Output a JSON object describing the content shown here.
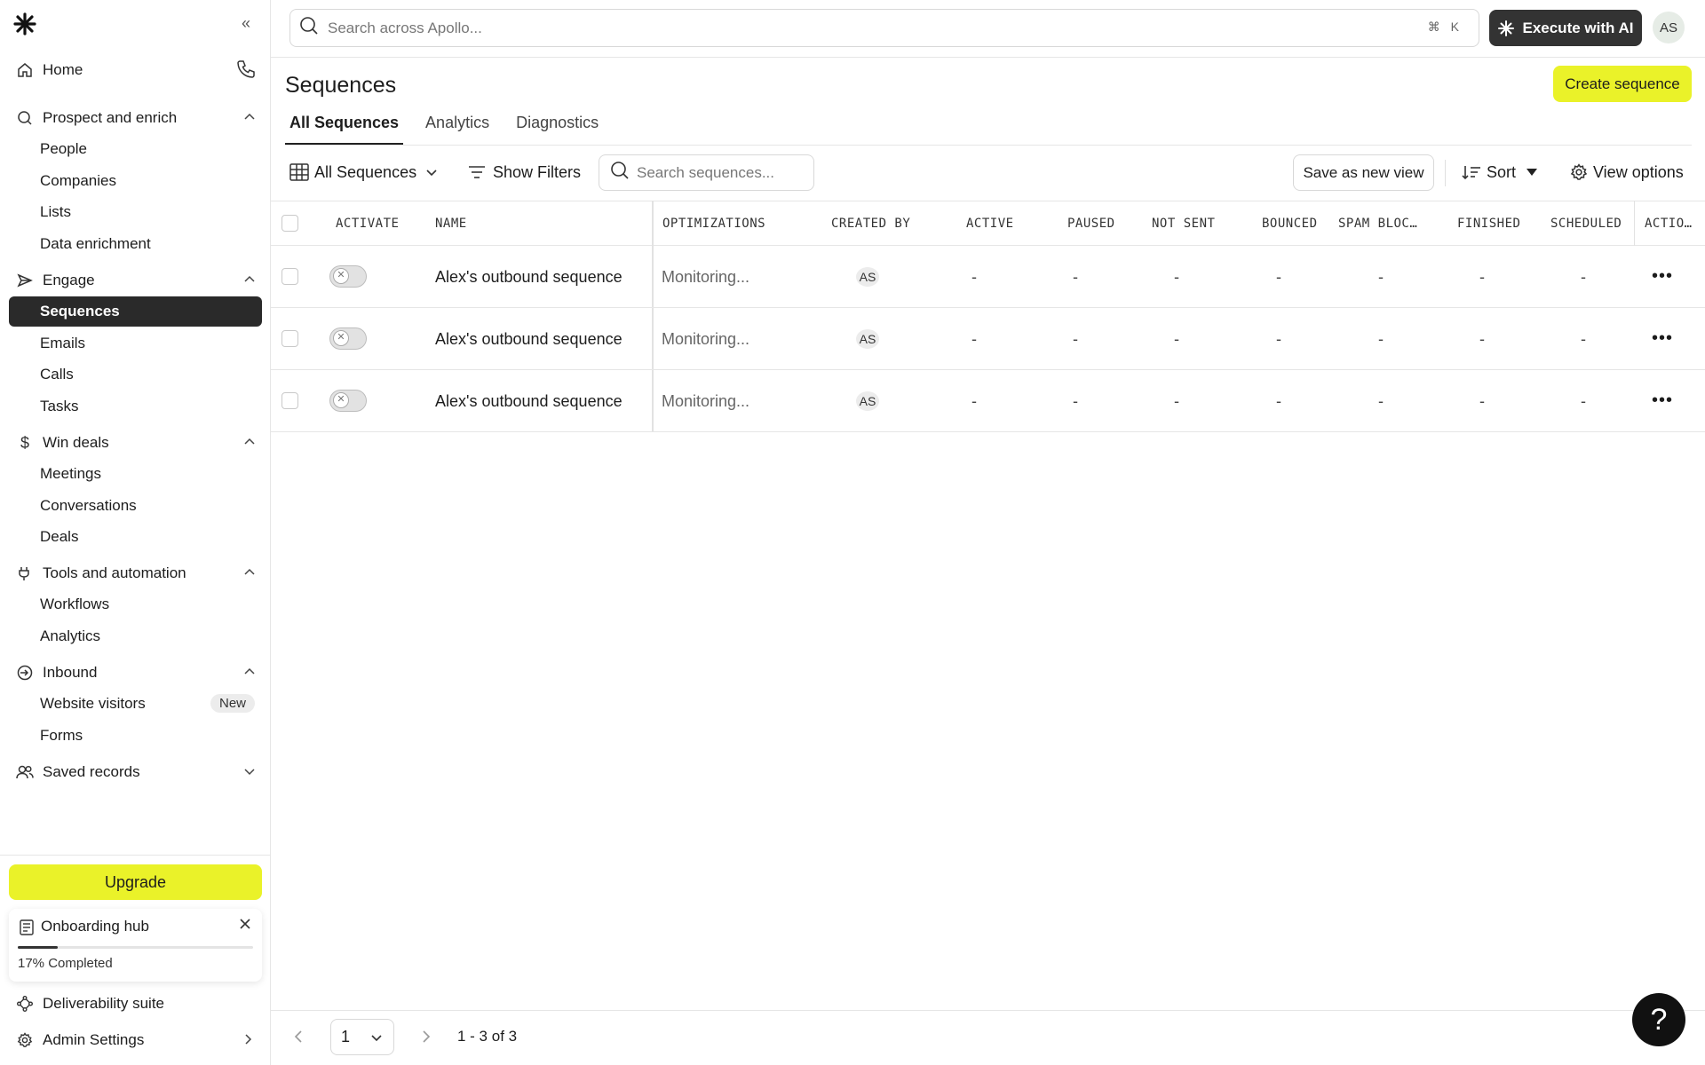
{
  "sidebar": {
    "home": "Home",
    "groups": {
      "prospect": {
        "label": "Prospect and enrich",
        "items": [
          "People",
          "Companies",
          "Lists",
          "Data enrichment"
        ]
      },
      "engage": {
        "label": "Engage",
        "items": [
          "Sequences",
          "Emails",
          "Calls",
          "Tasks"
        ]
      },
      "win": {
        "label": "Win deals",
        "items": [
          "Meetings",
          "Conversations",
          "Deals"
        ]
      },
      "tools": {
        "label": "Tools and automation",
        "items": [
          "Workflows",
          "Analytics"
        ]
      },
      "inbound": {
        "label": "Inbound",
        "items": [
          "Website visitors",
          "Forms"
        ]
      },
      "saved": {
        "label": "Saved records"
      }
    },
    "new_badge": "New",
    "upgrade": "Upgrade",
    "onboarding": {
      "title": "Onboarding hub",
      "progress_text": "17% Completed",
      "progress": 0.17
    },
    "deliverability": "Deliverability suite",
    "admin": "Admin Settings"
  },
  "topbar": {
    "search_placeholder": "Search across Apollo...",
    "shortcut": "⌘ K",
    "execute_ai": "Execute with AI",
    "avatar": "AS"
  },
  "header": {
    "title": "Sequences",
    "create": "Create sequence",
    "tabs": [
      "All Sequences",
      "Analytics",
      "Diagnostics"
    ]
  },
  "toolbar": {
    "view": "All Sequences",
    "filters": "Show Filters",
    "search_placeholder": "Search sequences...",
    "save_view": "Save as new view",
    "sort": "Sort",
    "view_options": "View options"
  },
  "table": {
    "columns": [
      "ACTIVATE",
      "NAME",
      "OPTIMIZATIONS",
      "CREATED BY",
      "ACTIVE",
      "PAUSED",
      "NOT SENT",
      "BOUNCED",
      "SPAM BLOC…",
      "FINISHED",
      "SCHEDULED",
      "ACTIO…"
    ],
    "rows": [
      {
        "name": "Alex's outbound sequence",
        "optimization": "Monitoring...",
        "created_by": "AS",
        "active": "-",
        "paused": "-",
        "not_sent": "-",
        "bounced": "-",
        "spam": "-",
        "finished": "-",
        "scheduled": "-"
      },
      {
        "name": "Alex's outbound sequence",
        "optimization": "Monitoring...",
        "created_by": "AS",
        "active": "-",
        "paused": "-",
        "not_sent": "-",
        "bounced": "-",
        "spam": "-",
        "finished": "-",
        "scheduled": "-"
      },
      {
        "name": "Alex's outbound sequence",
        "optimization": "Monitoring...",
        "created_by": "AS",
        "active": "-",
        "paused": "-",
        "not_sent": "-",
        "bounced": "-",
        "spam": "-",
        "finished": "-",
        "scheduled": "-"
      }
    ]
  },
  "pagination": {
    "page": "1",
    "range": "1 - 3 of 3"
  },
  "help": "?",
  "colors": {
    "accent": "#eaf229",
    "dark": "#2a2a2a"
  }
}
